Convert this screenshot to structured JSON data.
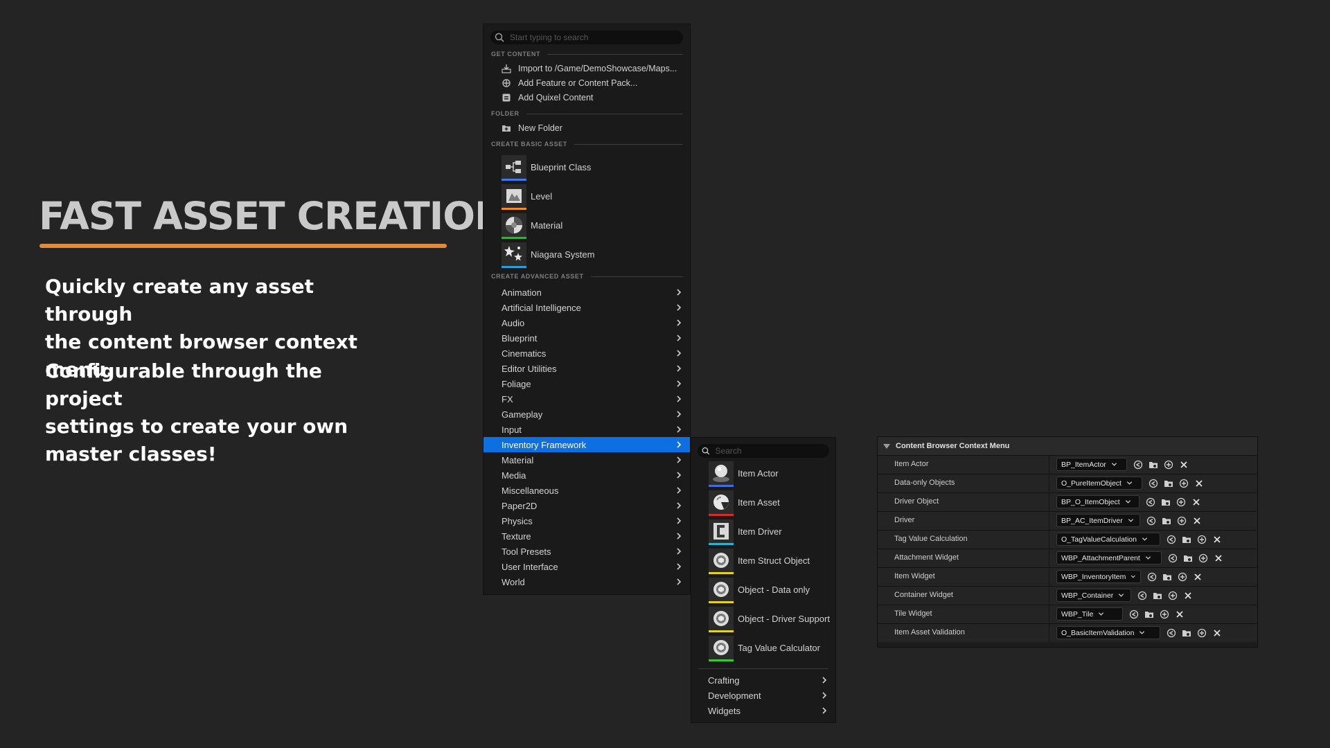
{
  "promo": {
    "title": "FAST ASSET CREATION",
    "paragraph1": "Quickly create any asset through\nthe content browser context menu.",
    "paragraph2": "Configurable through the project\nsettings to create your own\nmaster classes!",
    "accent_color": "#e08a3c"
  },
  "context_menu": {
    "search_placeholder": "Start typing to search",
    "sections": {
      "get_content": "GET CONTENT",
      "folder": "FOLDER",
      "create_basic": "CREATE BASIC ASSET",
      "create_advanced": "CREATE ADVANCED ASSET"
    },
    "get_content_items": [
      {
        "label": "Import to /Game/DemoShowcase/Maps...",
        "icon": "import-icon"
      },
      {
        "label": "Add Feature or Content Pack...",
        "icon": "feature-pack-icon"
      },
      {
        "label": "Add Quixel Content",
        "icon": "quixel-icon"
      }
    ],
    "folder_items": [
      {
        "label": "New Folder",
        "icon": "new-folder-icon"
      }
    ],
    "basic_assets": [
      {
        "label": "Blueprint Class",
        "icon": "blueprint-class-icon",
        "color": "#3d7bf0"
      },
      {
        "label": "Level",
        "icon": "level-icon",
        "color": "#f08c1e"
      },
      {
        "label": "Material",
        "icon": "material-icon",
        "color": "#3ca846"
      },
      {
        "label": "Niagara System",
        "icon": "niagara-icon",
        "color": "#2a9fd6"
      }
    ],
    "advanced_categories": [
      "Animation",
      "Artificial Intelligence",
      "Audio",
      "Blueprint",
      "Cinematics",
      "Editor Utilities",
      "Foliage",
      "FX",
      "Gameplay",
      "Input",
      "Inventory Framework",
      "Material",
      "Media",
      "Miscellaneous",
      "Paper2D",
      "Physics",
      "Texture",
      "Tool Presets",
      "User Interface",
      "World"
    ],
    "active_category": "Inventory Framework",
    "highlight_color": "#0e70e0"
  },
  "inventory_submenu": {
    "search_placeholder": "Search",
    "items": [
      {
        "label": "Item Actor",
        "icon": "item-actor-icon",
        "color": "#3d6fe0"
      },
      {
        "label": "Item Asset",
        "icon": "item-asset-icon",
        "color": "#d52b2b"
      },
      {
        "label": "Item Driver",
        "icon": "item-driver-icon",
        "color": "#27b5d6"
      },
      {
        "label": "Item Struct Object",
        "icon": "struct-object-icon",
        "color": "#e6d21e"
      },
      {
        "label": "Object - Data only",
        "icon": "data-object-icon",
        "color": "#e6d21e"
      },
      {
        "label": "Object - Driver Support",
        "icon": "driver-support-icon",
        "color": "#e6d21e"
      },
      {
        "label": "Tag Value Calculator",
        "icon": "tag-calculator-icon",
        "color": "#38c838"
      }
    ],
    "subcategories": [
      "Crafting",
      "Development",
      "Widgets"
    ]
  },
  "settings_panel": {
    "header": "Content Browser Context Menu",
    "rows": [
      {
        "label": "Item Actor",
        "value": "BP_ItemActor"
      },
      {
        "label": "Data-only Objects",
        "value": "O_PureItemObject"
      },
      {
        "label": "Driver Object",
        "value": "BP_O_ItemObject"
      },
      {
        "label": "Driver",
        "value": "BP_AC_ItemDriver"
      },
      {
        "label": "Tag Value Calculation",
        "value": "O_TagValueCalculation"
      },
      {
        "label": "Attachment Widget",
        "value": "WBP_AttachmentParent"
      },
      {
        "label": "Item Widget",
        "value": "WBP_InventoryItem"
      },
      {
        "label": "Container Widget",
        "value": "WBP_Container"
      },
      {
        "label": "Tile Widget",
        "value": "WBP_Tile"
      },
      {
        "label": "Item Asset Validation",
        "value": "O_BasicItemValidation"
      }
    ]
  }
}
